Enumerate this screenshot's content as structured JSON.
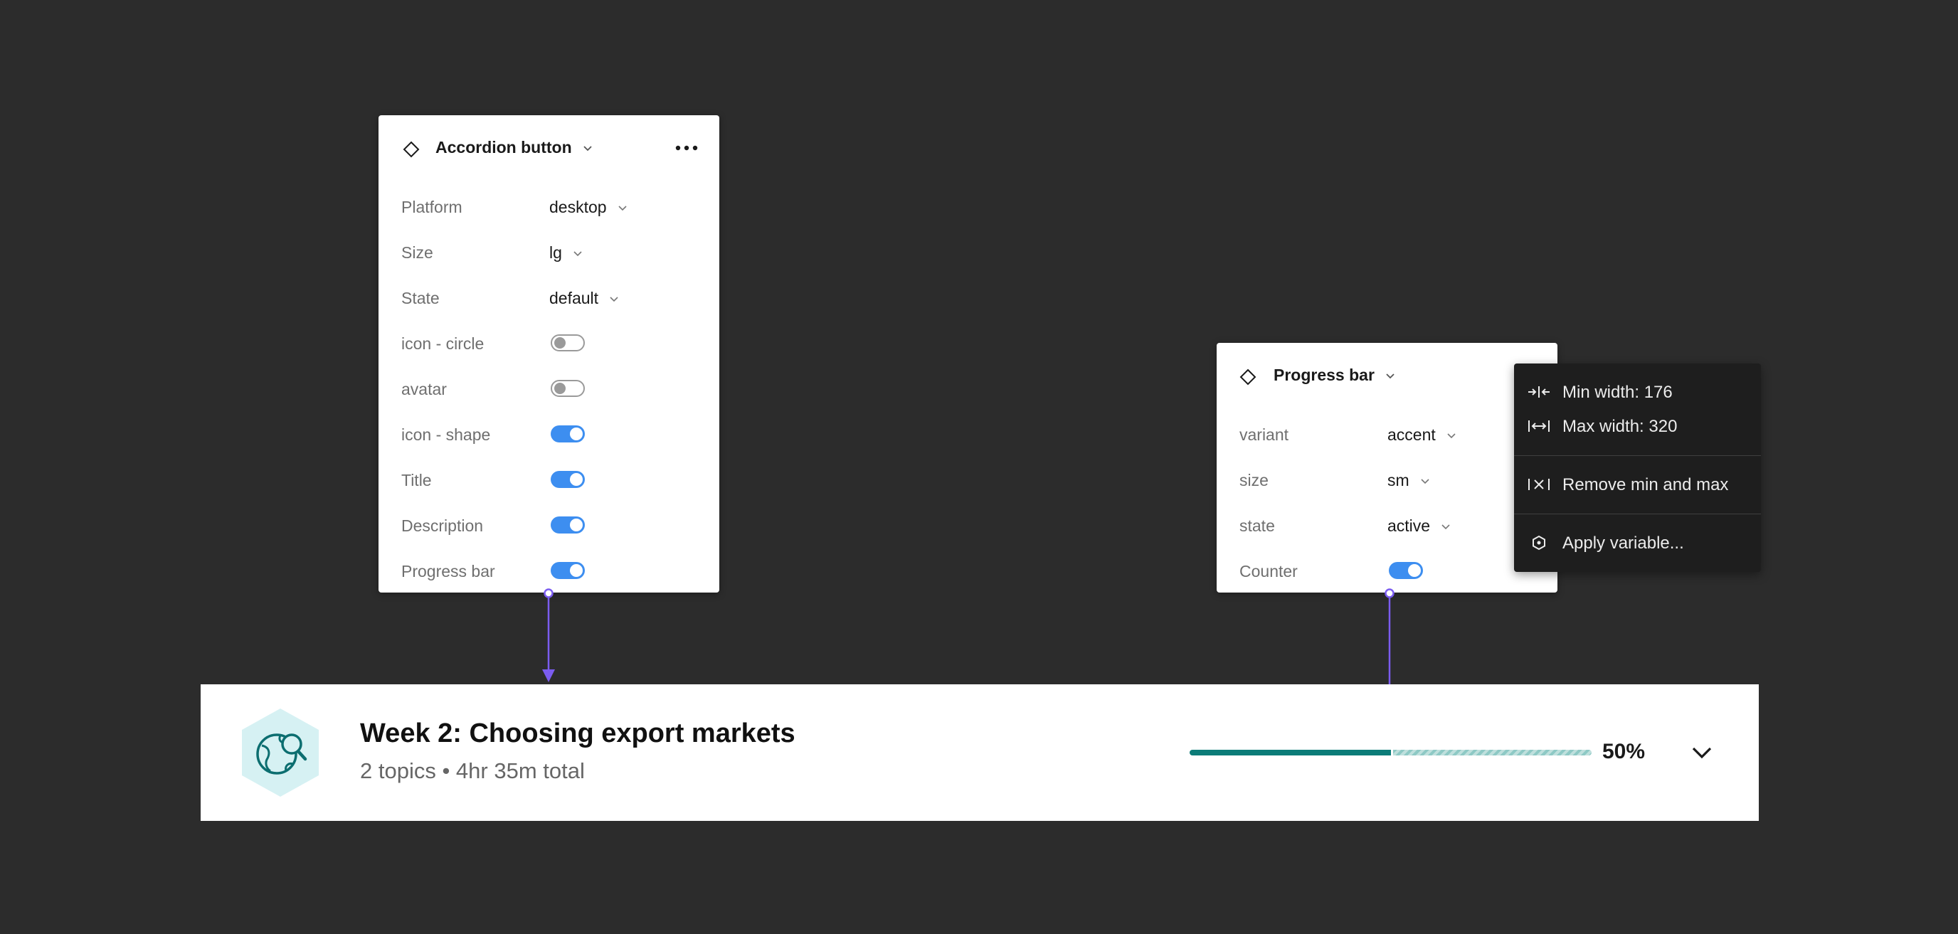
{
  "accordion_panel": {
    "title": "Accordion button",
    "props": [
      {
        "label": "Platform",
        "value": "desktop"
      },
      {
        "label": "Size",
        "value": "lg"
      },
      {
        "label": "State",
        "value": "default"
      }
    ],
    "toggles": [
      {
        "label": "icon - circle",
        "on": false
      },
      {
        "label": "avatar",
        "on": false
      },
      {
        "label": "icon - shape",
        "on": true
      },
      {
        "label": "Title",
        "on": true
      },
      {
        "label": "Description",
        "on": true
      },
      {
        "label": "Progress bar",
        "on": true
      }
    ]
  },
  "progress_panel": {
    "title": "Progress bar",
    "props": [
      {
        "label": "variant",
        "value": "accent"
      },
      {
        "label": "size",
        "value": "sm"
      },
      {
        "label": "state",
        "value": "active"
      }
    ],
    "toggles": [
      {
        "label": "Counter",
        "on": true
      }
    ]
  },
  "context_menu": {
    "min_width": "Min width: 176",
    "max_width": "Max width: 320",
    "remove": "Remove min and max",
    "apply_variable": "Apply variable..."
  },
  "accordion": {
    "title": "Week 2: Choosing export markets",
    "subtitle": "2 topics • 4hr 35m total",
    "progress_percent": 50,
    "progress_label": "50%"
  },
  "colors": {
    "canvas": "#2c2c2c",
    "toggle_on": "#3d8ef0",
    "connector": "#7b5cf0",
    "progress_fill": "#0c7c78",
    "icon_bg": "#d6f1f3"
  }
}
